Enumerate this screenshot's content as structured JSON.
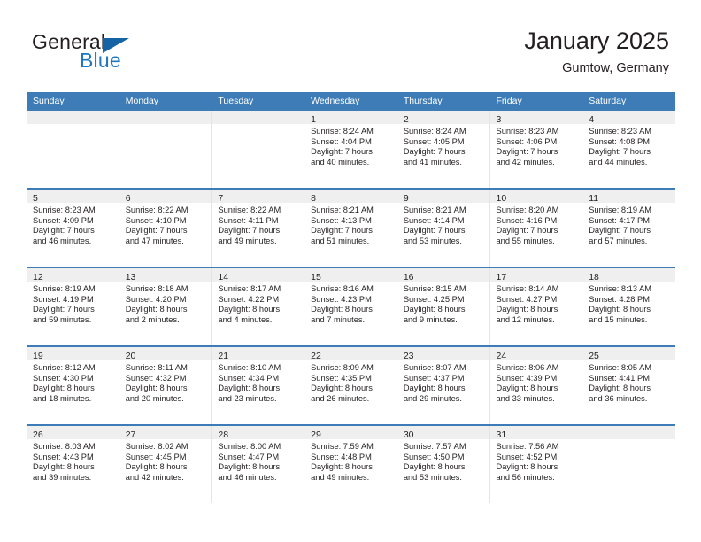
{
  "brand": {
    "name_part1": "General",
    "name_part2": "Blue",
    "flag_icon": "triangle-flag-icon",
    "accent_color": "#1464a5",
    "blue_text_color": "#2077c0"
  },
  "header": {
    "title": "January 2025",
    "subtitle": "Gumtow, Germany"
  },
  "theme": {
    "header_row_bg": "#3d7cb6",
    "header_row_text": "#ffffff",
    "week_divider": "#3d7cb6",
    "daynum_band_bg": "#efefef",
    "cell_border": "#e4e4e4",
    "body_text": "#231f20"
  },
  "calendar": {
    "weekday_headers": [
      "Sunday",
      "Monday",
      "Tuesday",
      "Wednesday",
      "Thursday",
      "Friday",
      "Saturday"
    ],
    "weeks": [
      [
        {
          "day": "",
          "lines": []
        },
        {
          "day": "",
          "lines": []
        },
        {
          "day": "",
          "lines": []
        },
        {
          "day": "1",
          "lines": [
            "Sunrise: 8:24 AM",
            "Sunset: 4:04 PM",
            "Daylight: 7 hours",
            "and 40 minutes."
          ]
        },
        {
          "day": "2",
          "lines": [
            "Sunrise: 8:24 AM",
            "Sunset: 4:05 PM",
            "Daylight: 7 hours",
            "and 41 minutes."
          ]
        },
        {
          "day": "3",
          "lines": [
            "Sunrise: 8:23 AM",
            "Sunset: 4:06 PM",
            "Daylight: 7 hours",
            "and 42 minutes."
          ]
        },
        {
          "day": "4",
          "lines": [
            "Sunrise: 8:23 AM",
            "Sunset: 4:08 PM",
            "Daylight: 7 hours",
            "and 44 minutes."
          ]
        }
      ],
      [
        {
          "day": "5",
          "lines": [
            "Sunrise: 8:23 AM",
            "Sunset: 4:09 PM",
            "Daylight: 7 hours",
            "and 46 minutes."
          ]
        },
        {
          "day": "6",
          "lines": [
            "Sunrise: 8:22 AM",
            "Sunset: 4:10 PM",
            "Daylight: 7 hours",
            "and 47 minutes."
          ]
        },
        {
          "day": "7",
          "lines": [
            "Sunrise: 8:22 AM",
            "Sunset: 4:11 PM",
            "Daylight: 7 hours",
            "and 49 minutes."
          ]
        },
        {
          "day": "8",
          "lines": [
            "Sunrise: 8:21 AM",
            "Sunset: 4:13 PM",
            "Daylight: 7 hours",
            "and 51 minutes."
          ]
        },
        {
          "day": "9",
          "lines": [
            "Sunrise: 8:21 AM",
            "Sunset: 4:14 PM",
            "Daylight: 7 hours",
            "and 53 minutes."
          ]
        },
        {
          "day": "10",
          "lines": [
            "Sunrise: 8:20 AM",
            "Sunset: 4:16 PM",
            "Daylight: 7 hours",
            "and 55 minutes."
          ]
        },
        {
          "day": "11",
          "lines": [
            "Sunrise: 8:19 AM",
            "Sunset: 4:17 PM",
            "Daylight: 7 hours",
            "and 57 minutes."
          ]
        }
      ],
      [
        {
          "day": "12",
          "lines": [
            "Sunrise: 8:19 AM",
            "Sunset: 4:19 PM",
            "Daylight: 7 hours",
            "and 59 minutes."
          ]
        },
        {
          "day": "13",
          "lines": [
            "Sunrise: 8:18 AM",
            "Sunset: 4:20 PM",
            "Daylight: 8 hours",
            "and 2 minutes."
          ]
        },
        {
          "day": "14",
          "lines": [
            "Sunrise: 8:17 AM",
            "Sunset: 4:22 PM",
            "Daylight: 8 hours",
            "and 4 minutes."
          ]
        },
        {
          "day": "15",
          "lines": [
            "Sunrise: 8:16 AM",
            "Sunset: 4:23 PM",
            "Daylight: 8 hours",
            "and 7 minutes."
          ]
        },
        {
          "day": "16",
          "lines": [
            "Sunrise: 8:15 AM",
            "Sunset: 4:25 PM",
            "Daylight: 8 hours",
            "and 9 minutes."
          ]
        },
        {
          "day": "17",
          "lines": [
            "Sunrise: 8:14 AM",
            "Sunset: 4:27 PM",
            "Daylight: 8 hours",
            "and 12 minutes."
          ]
        },
        {
          "day": "18",
          "lines": [
            "Sunrise: 8:13 AM",
            "Sunset: 4:28 PM",
            "Daylight: 8 hours",
            "and 15 minutes."
          ]
        }
      ],
      [
        {
          "day": "19",
          "lines": [
            "Sunrise: 8:12 AM",
            "Sunset: 4:30 PM",
            "Daylight: 8 hours",
            "and 18 minutes."
          ]
        },
        {
          "day": "20",
          "lines": [
            "Sunrise: 8:11 AM",
            "Sunset: 4:32 PM",
            "Daylight: 8 hours",
            "and 20 minutes."
          ]
        },
        {
          "day": "21",
          "lines": [
            "Sunrise: 8:10 AM",
            "Sunset: 4:34 PM",
            "Daylight: 8 hours",
            "and 23 minutes."
          ]
        },
        {
          "day": "22",
          "lines": [
            "Sunrise: 8:09 AM",
            "Sunset: 4:35 PM",
            "Daylight: 8 hours",
            "and 26 minutes."
          ]
        },
        {
          "day": "23",
          "lines": [
            "Sunrise: 8:07 AM",
            "Sunset: 4:37 PM",
            "Daylight: 8 hours",
            "and 29 minutes."
          ]
        },
        {
          "day": "24",
          "lines": [
            "Sunrise: 8:06 AM",
            "Sunset: 4:39 PM",
            "Daylight: 8 hours",
            "and 33 minutes."
          ]
        },
        {
          "day": "25",
          "lines": [
            "Sunrise: 8:05 AM",
            "Sunset: 4:41 PM",
            "Daylight: 8 hours",
            "and 36 minutes."
          ]
        }
      ],
      [
        {
          "day": "26",
          "lines": [
            "Sunrise: 8:03 AM",
            "Sunset: 4:43 PM",
            "Daylight: 8 hours",
            "and 39 minutes."
          ]
        },
        {
          "day": "27",
          "lines": [
            "Sunrise: 8:02 AM",
            "Sunset: 4:45 PM",
            "Daylight: 8 hours",
            "and 42 minutes."
          ]
        },
        {
          "day": "28",
          "lines": [
            "Sunrise: 8:00 AM",
            "Sunset: 4:47 PM",
            "Daylight: 8 hours",
            "and 46 minutes."
          ]
        },
        {
          "day": "29",
          "lines": [
            "Sunrise: 7:59 AM",
            "Sunset: 4:48 PM",
            "Daylight: 8 hours",
            "and 49 minutes."
          ]
        },
        {
          "day": "30",
          "lines": [
            "Sunrise: 7:57 AM",
            "Sunset: 4:50 PM",
            "Daylight: 8 hours",
            "and 53 minutes."
          ]
        },
        {
          "day": "31",
          "lines": [
            "Sunrise: 7:56 AM",
            "Sunset: 4:52 PM",
            "Daylight: 8 hours",
            "and 56 minutes."
          ]
        },
        {
          "day": "",
          "lines": []
        }
      ]
    ]
  }
}
